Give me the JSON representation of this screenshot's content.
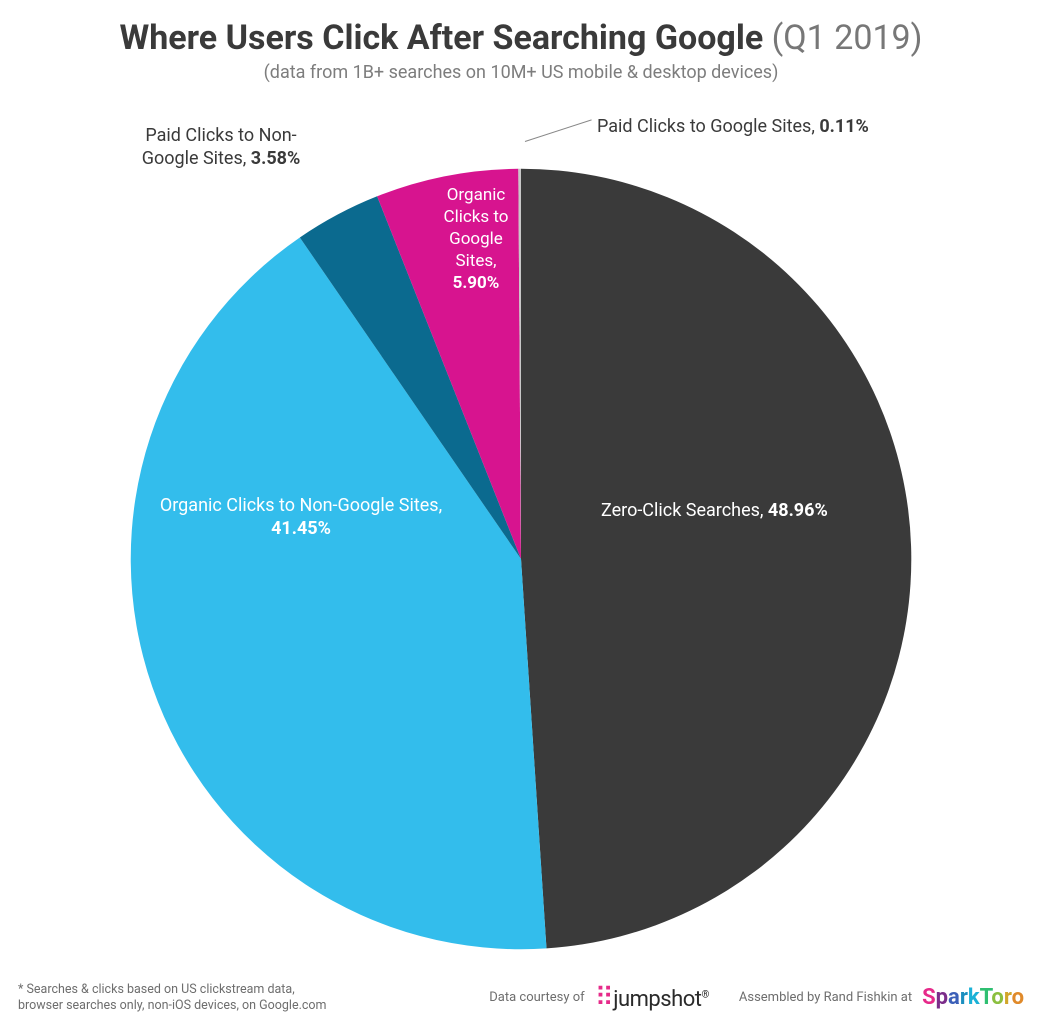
{
  "header": {
    "title_bold": "Where Users Click After Searching Google",
    "title_paren": "(Q1 2019)",
    "subtitle": "(data from 1B+ searches on 10M+ US mobile & desktop devices)"
  },
  "chart_data": {
    "type": "pie",
    "title": "Where Users Click After Searching Google (Q1 2019)",
    "categories": [
      "Zero-Click Searches",
      "Organic Clicks to Non-Google Sites",
      "Paid Clicks to Non-Google Sites",
      "Organic Clicks to Google Sites",
      "Paid Clicks to Google Sites"
    ],
    "values": [
      48.96,
      41.45,
      3.58,
      5.9,
      0.11
    ],
    "colors": [
      "#3a3a3a",
      "#33bdec",
      "#0b6a8f",
      "#d7148f",
      "#c7c7c7"
    ]
  },
  "slice_labels": {
    "zero": {
      "name": "Zero-Click Searches, ",
      "value": "48.96%"
    },
    "organic_non": {
      "name": "Organic Clicks to Non-Google Sites, ",
      "value": "41.45%"
    },
    "paid_non": {
      "name": "Paid Clicks to Non-Google Sites, ",
      "value": "3.58%"
    },
    "organic_g": {
      "name_l1": "Organic",
      "name_l2": "Clicks to",
      "name_l3": "Google",
      "name_l4": "Sites,",
      "value": "5.90%"
    },
    "paid_g": {
      "name": "Paid Clicks to Google Sites, ",
      "value": "0.11%"
    }
  },
  "footer": {
    "note_l1": "* Searches & clicks based on US clickstream data,",
    "note_l2": "browser searches only, non-iOS devices, on Google.com",
    "courtesy": "Data courtesy of",
    "jumpshot": "jumpshot",
    "assembled": "Assembled by Rand Fishkin at",
    "sparktoro": "SparkToro"
  }
}
